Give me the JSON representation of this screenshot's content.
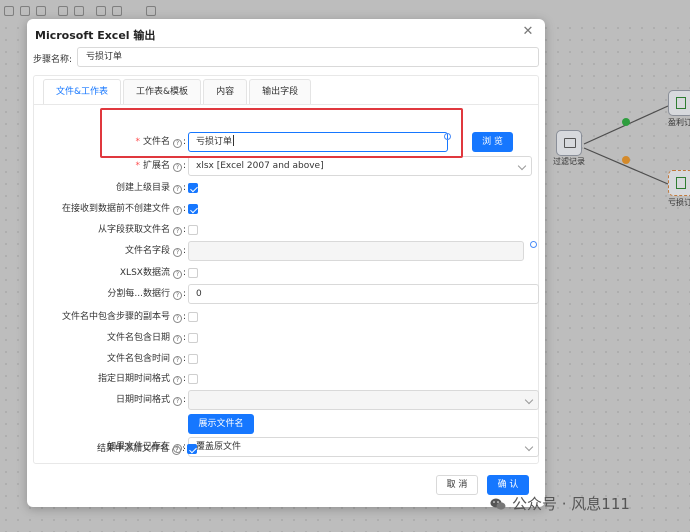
{
  "dialog": {
    "title": "Microsoft Excel 输出",
    "step_name_label": "步骤名称:",
    "step_name_value": "亏损订单"
  },
  "tabs": [
    {
      "label": "文件&工作表",
      "active": true
    },
    {
      "label": "工作表&模板",
      "active": false
    },
    {
      "label": "内容",
      "active": false
    },
    {
      "label": "输出字段",
      "active": false
    }
  ],
  "form": {
    "filename": {
      "label": "文件名",
      "value": "亏损订单",
      "required": true
    },
    "browse_button": "浏 览",
    "extension": {
      "label": "扩展名",
      "value": "xlsx [Excel 2007 and above]",
      "required": true
    },
    "create_parent_dir": {
      "label": "创建上级目录",
      "checked": true
    },
    "no_create_until_data": {
      "label": "在接收到数据前不创建文件",
      "checked": true
    },
    "filename_from_field": {
      "label": "从字段获取文件名",
      "checked": false
    },
    "filename_field": {
      "label": "文件名字段",
      "value": ""
    },
    "xlsx_stream": {
      "label": "XLSX数据流",
      "checked": false
    },
    "split_rows": {
      "label": "分割每...数据行",
      "value": "0"
    },
    "include_step_copy": {
      "label": "文件名中包含步骤的副本号",
      "checked": false
    },
    "include_date": {
      "label": "文件名包含日期",
      "checked": false
    },
    "include_time": {
      "label": "文件名包含时间",
      "checked": false
    },
    "specify_datetime_format": {
      "label": "指定日期时间格式",
      "checked": false
    },
    "datetime_format": {
      "label": "日期时间格式",
      "value": ""
    },
    "show_filename_button": "展示文件名",
    "if_file_exists": {
      "label": "如果文件已存在",
      "value": "覆盖原文件"
    },
    "add_filename_to_result": {
      "label": "结果中添加文件名",
      "checked": true
    }
  },
  "footer": {
    "cancel": "取 消",
    "confirm": "确 认"
  },
  "canvas": {
    "nodes": [
      {
        "label": "过滤记录"
      },
      {
        "label": "盈利订"
      },
      {
        "label": "亏损订"
      }
    ]
  },
  "watermark": "公众号 · 风息111",
  "colors": {
    "primary": "#1677ff",
    "required": "#ff4d4f",
    "highlight": "#e0383e",
    "success": "#2e9e3e",
    "warning": "#d48a2b"
  }
}
